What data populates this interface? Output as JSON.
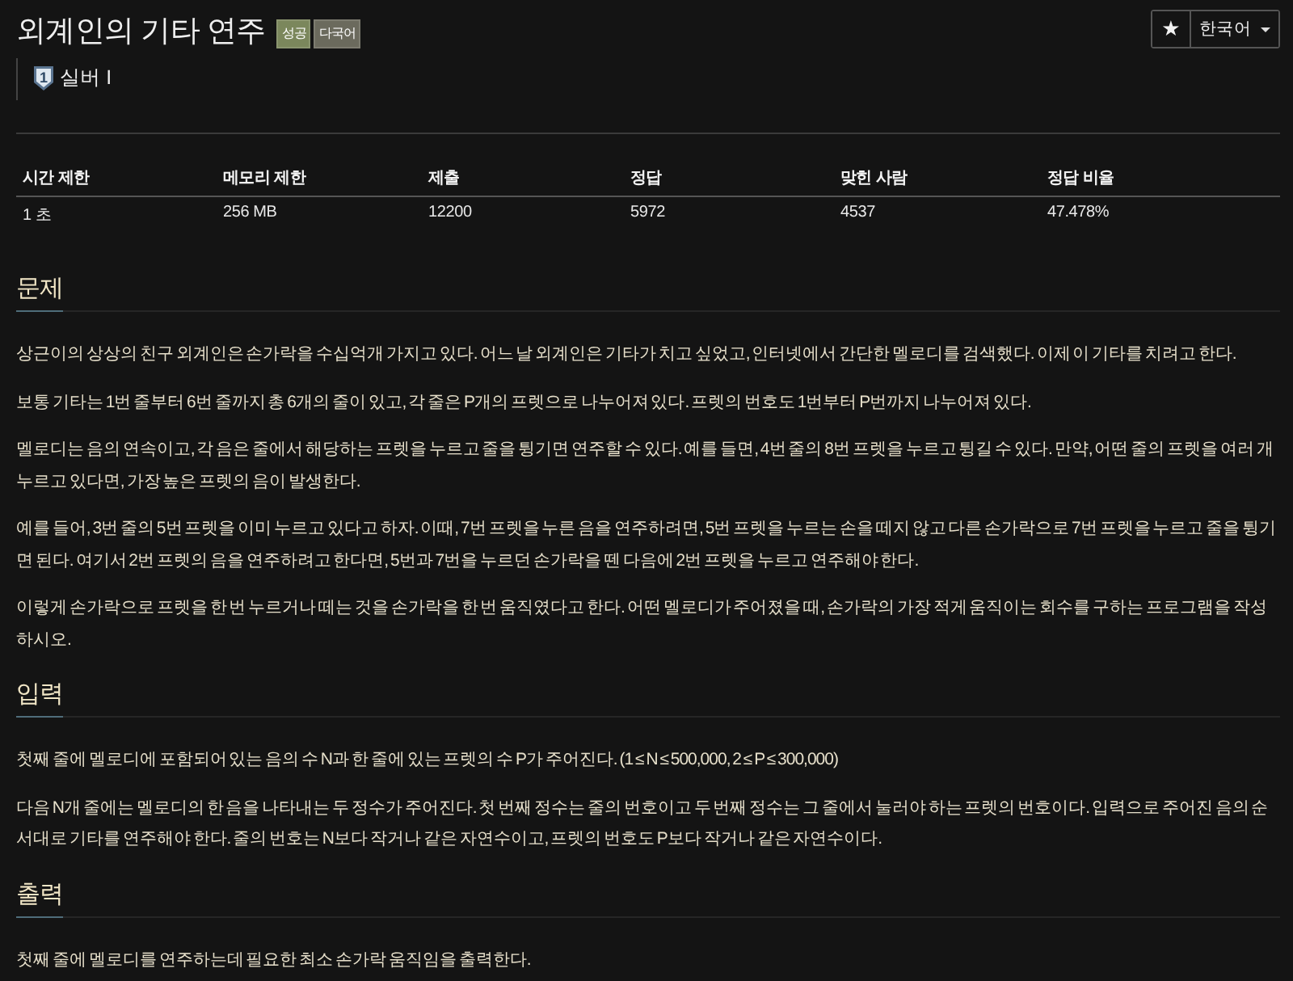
{
  "header": {
    "title": "외계인의 기타 연주",
    "badges": [
      {
        "label": "성공",
        "kind": "result"
      },
      {
        "label": "다국어",
        "kind": "language"
      }
    ],
    "star_button": "★",
    "language_select": "한국어"
  },
  "tier": {
    "rank": "1",
    "label": "실버 I"
  },
  "stats_table": {
    "columns": [
      "시간 제한",
      "메모리 제한",
      "제출",
      "정답",
      "맞힌 사람",
      "정답 비율"
    ],
    "rows": [
      [
        "1 초",
        "256 MB",
        "12200",
        "5972",
        "4537",
        "47.478%"
      ]
    ]
  },
  "sections": [
    {
      "heading": "문제",
      "paragraphs": [
        "상근이의 상상의 친구 외계인은 손가락을 수십억개 가지고 있다. 어느 날 외계인은 기타가 치고 싶었고, 인터넷에서 간단한 멜로디를 검색했다. 이제 이 기타를 치려고 한다.",
        "보통 기타는 1번 줄부터 6번 줄까지 총 6개의 줄이 있고, 각 줄은 P개의 프렛으로 나누어져 있다. 프렛의 번호도 1번부터 P번까지 나누어져 있다.",
        "멜로디는 음의 연속이고, 각 음은 줄에서 해당하는 프렛을 누르고 줄을 튕기면 연주할 수 있다. 예를 들면, 4번 줄의 8번 프렛을 누르고 튕길 수 있다. 만약, 어떤 줄의 프렛을 여러 개 누르고 있다면, 가장 높은 프렛의 음이 발생한다.",
        "예를 들어, 3번 줄의 5번 프렛을 이미 누르고 있다고 하자. 이때, 7번 프렛을 누른 음을 연주하려면, 5번 프렛을 누르는 손을 떼지 않고 다른 손가락으로 7번 프렛을 누르고 줄을 튕기면 된다. 여기서 2번 프렛의 음을 연주하려고 한다면, 5번과 7번을 누르던 손가락을 뗀 다음에 2번 프렛을 누르고 연주해야 한다.",
        "이렇게 손가락으로 프렛을 한 번 누르거나 떼는 것을 손가락을 한 번 움직였다고 한다. 어떤 멜로디가 주어졌을 때, 손가락의 가장 적게 움직이는 회수를 구하는 프로그램을 작성하시오."
      ]
    },
    {
      "heading": "입력",
      "paragraphs": [
        "첫째 줄에 멜로디에 포함되어 있는 음의 수 N과 한 줄에 있는 프렛의 수 P가 주어진다. (1 ≤ N ≤ 500,000, 2 ≤ P ≤ 300,000)",
        "다음 N개 줄에는 멜로디의 한 음을 나타내는 두 정수가 주어진다. 첫 번째 정수는 줄의 번호이고 두 번째 정수는 그 줄에서 눌러야 하는 프렛의 번호이다. 입력으로 주어진 음의 순서대로 기타를 연주해야 한다. 줄의 번호는 N보다 작거나 같은 자연수이고, 프렛의 번호도 P보다 작거나 같은 자연수이다."
      ]
    },
    {
      "heading": "출력",
      "paragraphs": [
        "첫째 줄에 멜로디를 연주하는데 필요한 최소 손가락 움직임을 출력한다."
      ]
    }
  ]
}
